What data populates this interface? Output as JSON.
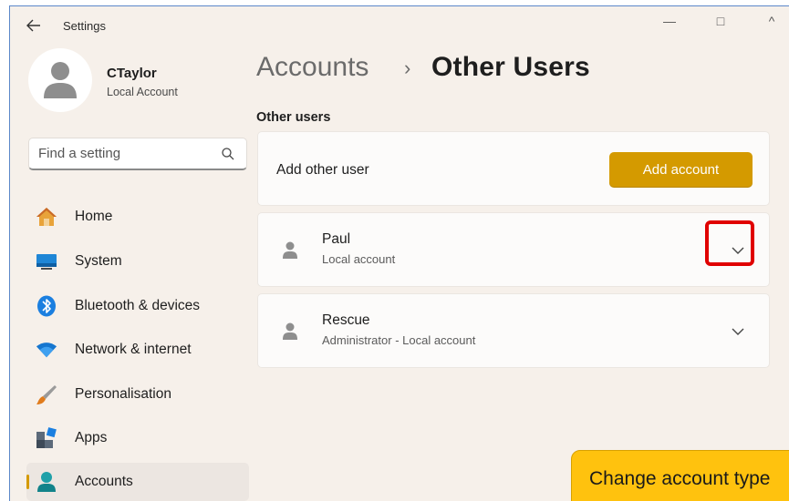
{
  "window": {
    "title": "Settings",
    "controls": {
      "minimize": "—",
      "maximize": "□",
      "close": "^"
    }
  },
  "profile": {
    "name": "CTaylor",
    "account_type": "Local Account"
  },
  "search": {
    "placeholder": "Find a setting"
  },
  "nav": {
    "items": [
      {
        "label": "Home",
        "icon": "home-icon"
      },
      {
        "label": "System",
        "icon": "monitor-icon"
      },
      {
        "label": "Bluetooth & devices",
        "icon": "bluetooth-icon"
      },
      {
        "label": "Network & internet",
        "icon": "wifi-icon"
      },
      {
        "label": "Personalisation",
        "icon": "brush-icon"
      },
      {
        "label": "Apps",
        "icon": "apps-icon"
      },
      {
        "label": "Accounts",
        "icon": "accounts-icon",
        "selected": true
      }
    ]
  },
  "breadcrumb": {
    "parent": "Accounts",
    "separator": "›",
    "current": "Other Users"
  },
  "section": {
    "title": "Other users"
  },
  "add_user": {
    "label": "Add other user",
    "button_label": "Add account"
  },
  "users": [
    {
      "name": "Paul",
      "subtitle": "Local account"
    },
    {
      "name": "Rescue",
      "subtitle": "Administrator - Local account"
    }
  ],
  "callout": {
    "text": "Change account type"
  },
  "colors": {
    "accent": "#d49a00",
    "window_bg": "#f6f0ea",
    "highlight": "#e00000",
    "callout_bg": "#ffc20e"
  }
}
